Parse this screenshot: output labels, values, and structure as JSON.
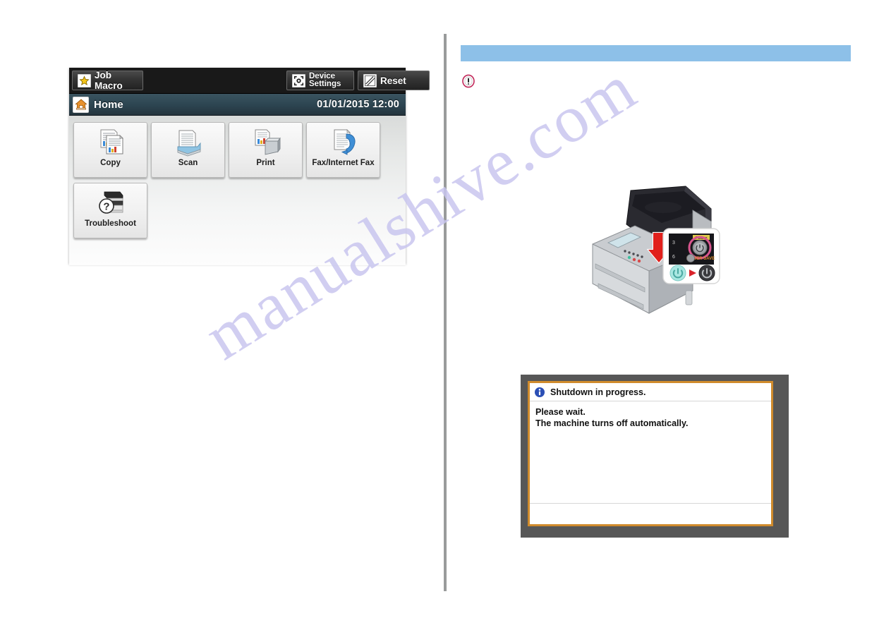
{
  "page": {
    "watermark": "manualshive.com",
    "divider": "vertical-column-rule"
  },
  "operation_panel": {
    "toolbar": {
      "buttons": [
        {
          "label": "Job Macro",
          "icon": "star-icon"
        },
        {
          "label_line1": "Device",
          "label_line2": "Settings",
          "icon": "device-settings-icon"
        },
        {
          "label": "Reset",
          "icon": "reset-icon"
        }
      ]
    },
    "titlebar": {
      "icon": "home-icon",
      "title": "Home",
      "datetime": "01/01/2015 12:00"
    },
    "apps_row1": [
      {
        "label": "Copy",
        "icon": "copy-icon"
      },
      {
        "label": "Scan",
        "icon": "scan-icon"
      },
      {
        "label": "Print",
        "icon": "print-icon"
      },
      {
        "label": "Fax/Internet Fax",
        "icon": "fax-icon"
      }
    ],
    "apps_row2": [
      {
        "label": "Troubleshoot",
        "icon": "troubleshoot-icon"
      }
    ]
  },
  "right_column": {
    "heading_bar": {
      "text": "",
      "color": "#8dc0e8"
    },
    "note_icon": "exclamation-circle-icon",
    "figure": {
      "name": "printer-power-button-illustration",
      "arrow": "down-arrow-indicator",
      "callout": {
        "keypad_power_label": "Power",
        "power_on_button": "power-icon-lit",
        "transition_marker": "right-triangle-icon",
        "power_off_button": "power-icon-off"
      }
    }
  },
  "shutdown_dialog": {
    "icon": "info-icon",
    "title": "Shutdown in progress.",
    "lines": [
      "Please wait.",
      "The machine turns off automatically."
    ],
    "border_color": "#d08b2c",
    "frame_color": "#575757"
  }
}
